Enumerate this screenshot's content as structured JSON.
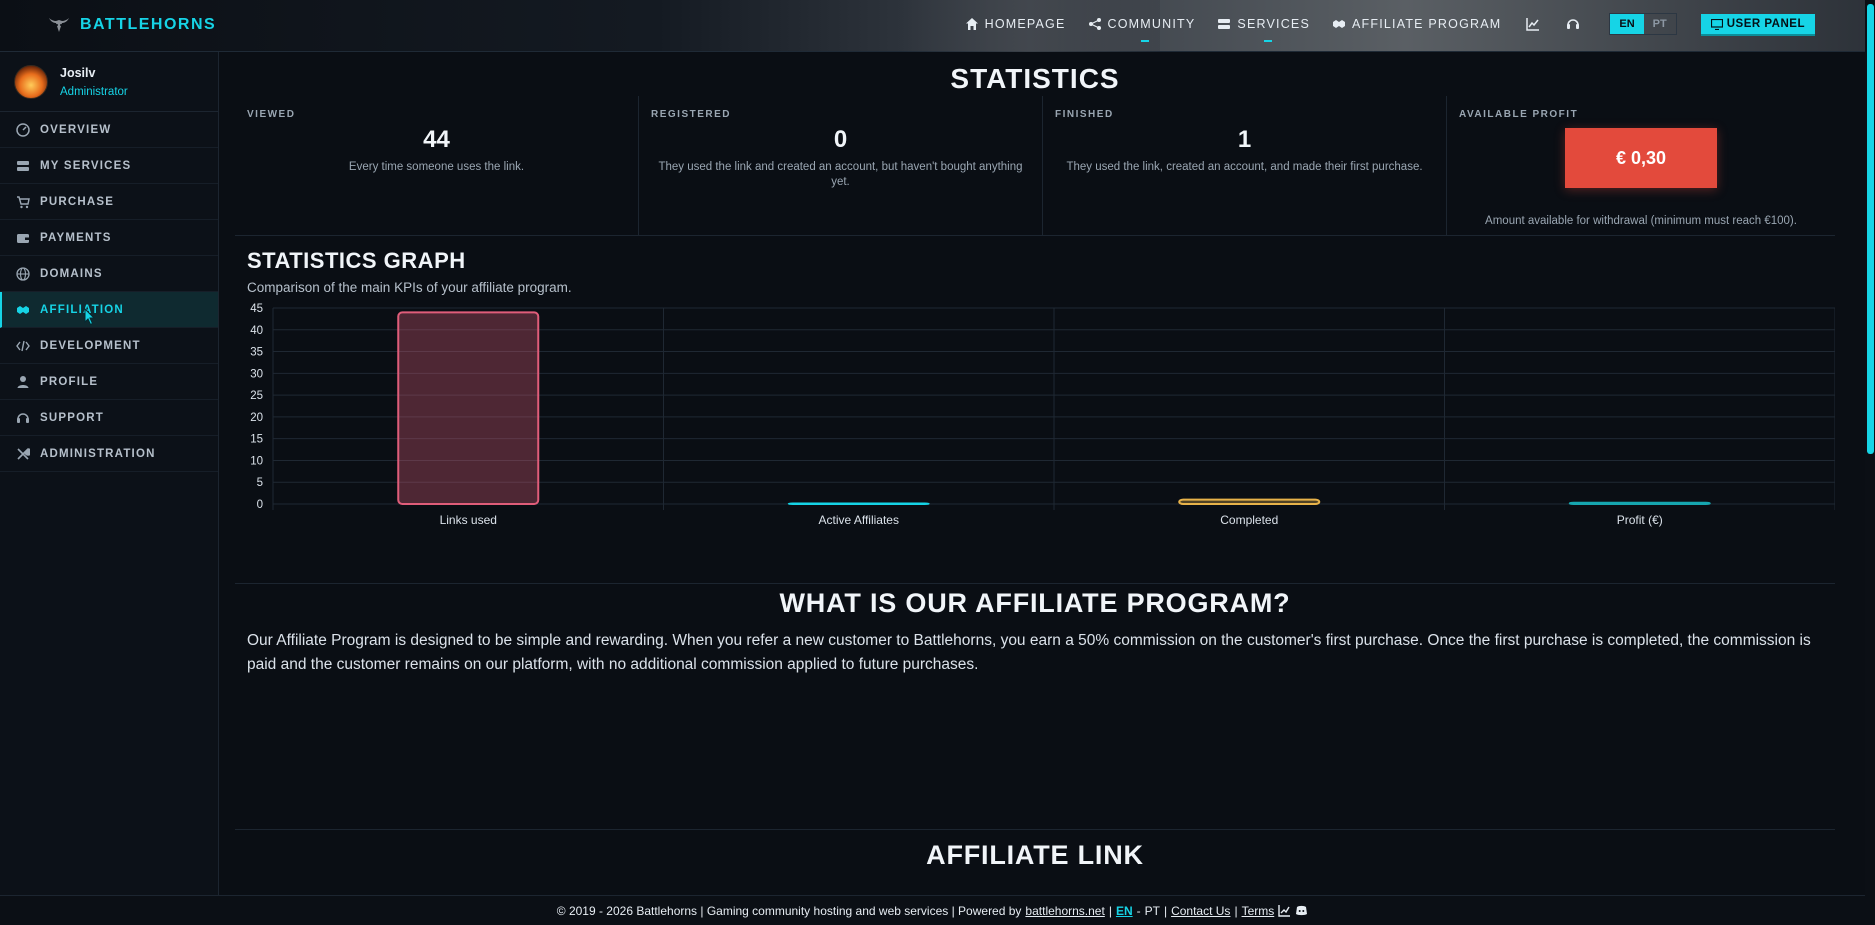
{
  "brand": {
    "name": "BATTLEHORNS"
  },
  "nav": {
    "items": [
      {
        "label": "HOMEPAGE",
        "icon": "home-icon"
      },
      {
        "label": "COMMUNITY",
        "icon": "share-icon"
      },
      {
        "label": "SERVICES",
        "icon": "server-icon"
      },
      {
        "label": "AFFILIATE PROGRAM",
        "icon": "handshake-icon"
      }
    ],
    "lang_en": "EN",
    "lang_pt": "PT",
    "user_panel": "USER PANEL"
  },
  "user": {
    "name": "Josilv",
    "role": "Administrator"
  },
  "sidebar": {
    "items": [
      {
        "label": "OVERVIEW",
        "icon": "dashboard-icon"
      },
      {
        "label": "MY SERVICES",
        "icon": "server-icon"
      },
      {
        "label": "PURCHASE",
        "icon": "cart-icon"
      },
      {
        "label": "PAYMENTS",
        "icon": "wallet-icon"
      },
      {
        "label": "DOMAINS",
        "icon": "globe-icon"
      },
      {
        "label": "AFFILIATION",
        "icon": "handshake-icon"
      },
      {
        "label": "DEVELOPMENT",
        "icon": "code-icon"
      },
      {
        "label": "PROFILE",
        "icon": "user-icon"
      },
      {
        "label": "SUPPORT",
        "icon": "headset-icon"
      },
      {
        "label": "ADMINISTRATION",
        "icon": "tools-icon"
      }
    ]
  },
  "main": {
    "title": "STATISTICS",
    "stats": [
      {
        "label": "VIEWED",
        "value": "44",
        "desc": "Every time someone uses the link."
      },
      {
        "label": "REGISTERED",
        "value": "0",
        "desc": "They used the link and created an account, but haven't bought anything yet."
      },
      {
        "label": "FINISHED",
        "value": "1",
        "desc": "They used the link, created an account, and made their first purchase."
      },
      {
        "label": "AVAILABLE PROFIT",
        "value": "€ 0,30",
        "desc": "Amount available for withdrawal (minimum must reach €100)."
      }
    ],
    "graph_title": "STATISTICS GRAPH",
    "graph_subtitle": "Comparison of the main KPIs of your affiliate program.",
    "affiliate_title": "WHAT IS OUR AFFILIATE PROGRAM?",
    "affiliate_text": "Our Affiliate Program is designed to be simple and rewarding. When you refer a new customer to Battlehorns, you earn a 50% commission on the customer's first purchase. Once the first purchase is completed, the commission is paid and the customer remains on our platform, with no additional commission applied to future purchases.",
    "affiliate_link_title": "AFFILIATE LINK"
  },
  "chart_data": {
    "type": "bar",
    "categories": [
      "Links used",
      "Active Affiliates",
      "Completed",
      "Profit (€)"
    ],
    "values": [
      44,
      0,
      1,
      0.3
    ],
    "colors": [
      "#e05d7a",
      "#16d4e6",
      "#e8b34a",
      "#16a6b0"
    ],
    "ylim": [
      0,
      45
    ],
    "yticks": [
      0,
      5,
      10,
      15,
      20,
      25,
      30,
      35,
      40,
      45
    ],
    "grid": true
  },
  "footer": {
    "copyright": "© 2019 - 2026 Battlehorns | Gaming community hosting and web services | Powered by",
    "powered_link": "battlehorns.net",
    "sep1": "|",
    "lang_en": "EN",
    "dash": "-",
    "lang_pt": "PT",
    "sep2": "|",
    "contact": "Contact Us",
    "sep3": "|",
    "terms": "Terms"
  },
  "colors": {
    "accent": "#16d4e6",
    "profit": "#e34a3c",
    "background": "#0a0e14"
  }
}
